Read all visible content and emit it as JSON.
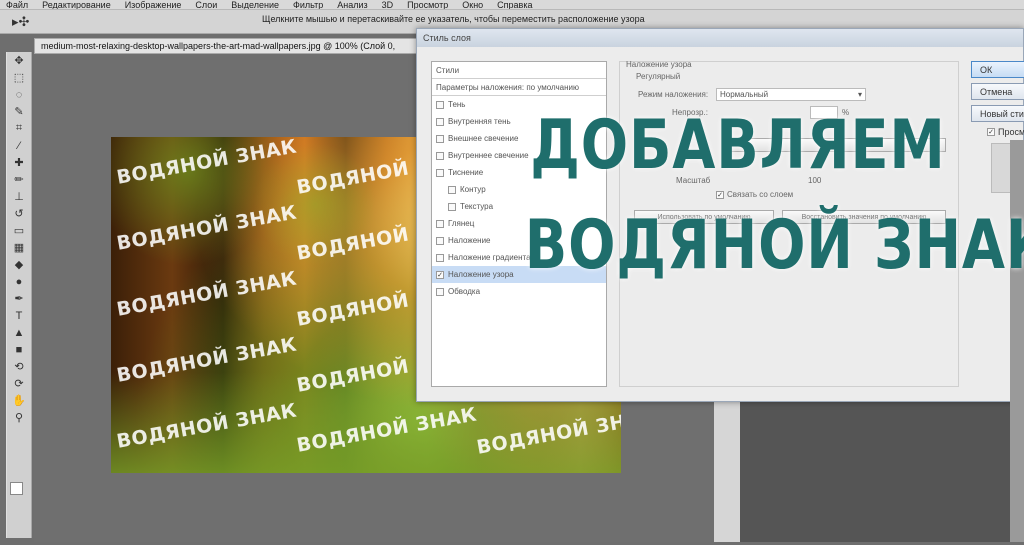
{
  "menu": [
    "Файл",
    "Редактирование",
    "Изображение",
    "Слои",
    "Выделение",
    "Фильтр",
    "Анализ",
    "3D",
    "Просмотр",
    "Окно",
    "Справка"
  ],
  "options_bar": {
    "tool_icon": "move-tool-icon",
    "hint": "Щелкните мышью и перетаскивайте ее указатель, чтобы переместить расположение узора"
  },
  "document": {
    "tab_title": "medium-most-relaxing-desktop-wallpapers-the-art-mad-wallpapers.jpg @ 100% (Слой 0,"
  },
  "watermark_text": "ВОДЯНОЙ ЗНАК",
  "dialog": {
    "title": "Стиль слоя",
    "styles_header": "Стили",
    "blend_options": "Параметры наложения: по умолчанию",
    "effects": [
      {
        "label": "Тень",
        "checked": false,
        "sub": false
      },
      {
        "label": "Внутренняя тень",
        "checked": false,
        "sub": false
      },
      {
        "label": "Внешнее свечение",
        "checked": false,
        "sub": false
      },
      {
        "label": "Внутреннее свечение",
        "checked": false,
        "sub": false
      },
      {
        "label": "Тиснение",
        "checked": false,
        "sub": false
      },
      {
        "label": "Контур",
        "checked": false,
        "sub": true
      },
      {
        "label": "Текстура",
        "checked": false,
        "sub": true
      },
      {
        "label": "Глянец",
        "checked": false,
        "sub": false
      },
      {
        "label": "Наложение",
        "checked": false,
        "sub": false
      },
      {
        "label": "Наложение градиента",
        "checked": false,
        "sub": false
      },
      {
        "label": "Наложение узора",
        "checked": true,
        "sub": false,
        "selected": true
      },
      {
        "label": "Обводка",
        "checked": false,
        "sub": false
      }
    ],
    "pattern_section": "Наложение узора",
    "pattern_group": "Регулярный",
    "blend_mode_label": "Режим наложения:",
    "blend_mode_value": "Нормальный",
    "opacity_label": "Непрозр.:",
    "opacity_unit": "%",
    "scale_label": "Масштаб",
    "scale_value": "100",
    "link_label": "Связать со слоем",
    "link_checked": true,
    "btn_default": "Использовать по умолчанию",
    "btn_restore": "Восстановить значения по умолчанию",
    "buttons": {
      "ok": "ОК",
      "cancel": "Отмена",
      "new_style": "Новый стиль...",
      "preview": "Просмотр"
    },
    "preview_checked": true
  },
  "overlay": {
    "line1": "ДОБАВЛЯЕМ",
    "line2": "ВОДЯНОЙ ЗНАК"
  },
  "colors": {
    "overlay_text": "#1f6e6c",
    "selection": "#c8dcf5"
  }
}
